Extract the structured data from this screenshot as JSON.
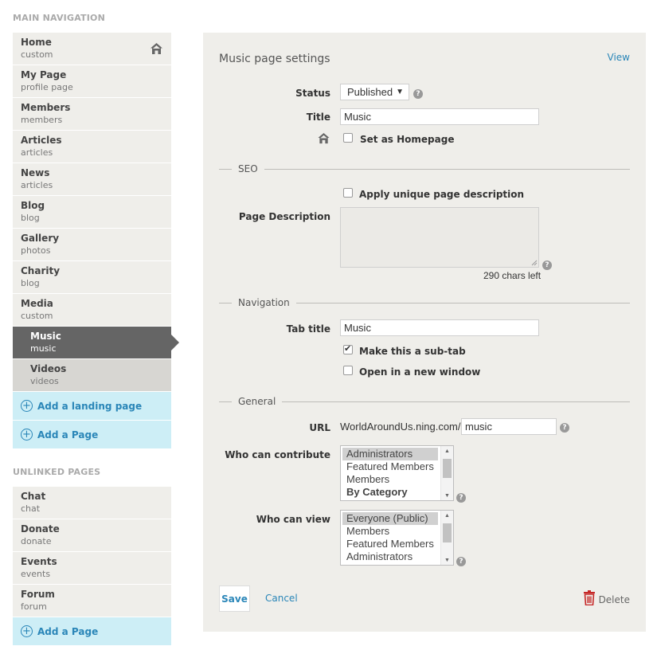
{
  "sidebar": {
    "main_heading": "MAIN NAVIGATION",
    "main_items": [
      {
        "name": "Home",
        "slug": "custom"
      },
      {
        "name": "My Page",
        "slug": "profile page"
      },
      {
        "name": "Members",
        "slug": "members"
      },
      {
        "name": "Articles",
        "slug": "articles"
      },
      {
        "name": "News",
        "slug": "articles"
      },
      {
        "name": "Blog",
        "slug": "blog"
      },
      {
        "name": "Gallery",
        "slug": "photos"
      },
      {
        "name": "Charity",
        "slug": "blog"
      },
      {
        "name": "Media",
        "slug": "custom"
      },
      {
        "name": "Music",
        "slug": "music"
      },
      {
        "name": "Videos",
        "slug": "videos"
      }
    ],
    "add_landing": "Add a landing page",
    "add_page": "Add a Page",
    "unlinked_heading": "UNLINKED PAGES",
    "unlinked_items": [
      {
        "name": "Chat",
        "slug": "chat"
      },
      {
        "name": "Donate",
        "slug": "donate"
      },
      {
        "name": "Events",
        "slug": "events"
      },
      {
        "name": "Forum",
        "slug": "forum"
      }
    ],
    "add_page_2": "Add a Page"
  },
  "panel": {
    "title": "Music page settings",
    "view_link": "View",
    "status_label": "Status",
    "status_value": "Published",
    "title_label": "Title",
    "title_value": "Music",
    "homepage_label": "Set as Homepage",
    "homepage_checked": false,
    "seo_heading": "SEO",
    "unique_desc_label": "Apply unique page description",
    "unique_desc_checked": false,
    "page_desc_label": "Page Description",
    "chars_left": "290 chars left",
    "navigation_heading": "Navigation",
    "tab_title_label": "Tab title",
    "tab_title_value": "Music",
    "subtab_label": "Make this a sub-tab",
    "subtab_checked": true,
    "new_window_label": "Open in a new window",
    "new_window_checked": false,
    "general_heading": "General",
    "url_label": "URL",
    "url_prefix": "WorldAroundUs.ning.com/",
    "url_value": "music",
    "contribute_label": "Who can contribute",
    "contribute_options": [
      "Administrators",
      "Featured Members",
      "Members",
      "By Category"
    ],
    "view_label": "Who can view",
    "view_options": [
      "Everyone (Public)",
      "Members",
      "Featured Members",
      "Administrators"
    ],
    "save_label": "Save",
    "cancel_label": "Cancel",
    "delete_label": "Delete"
  },
  "colors": {
    "accent": "#2a86b8",
    "panel_bg": "#efeeea",
    "active_nav": "#656565",
    "add_bg": "#cdeef6",
    "delete_icon": "#c62828"
  }
}
